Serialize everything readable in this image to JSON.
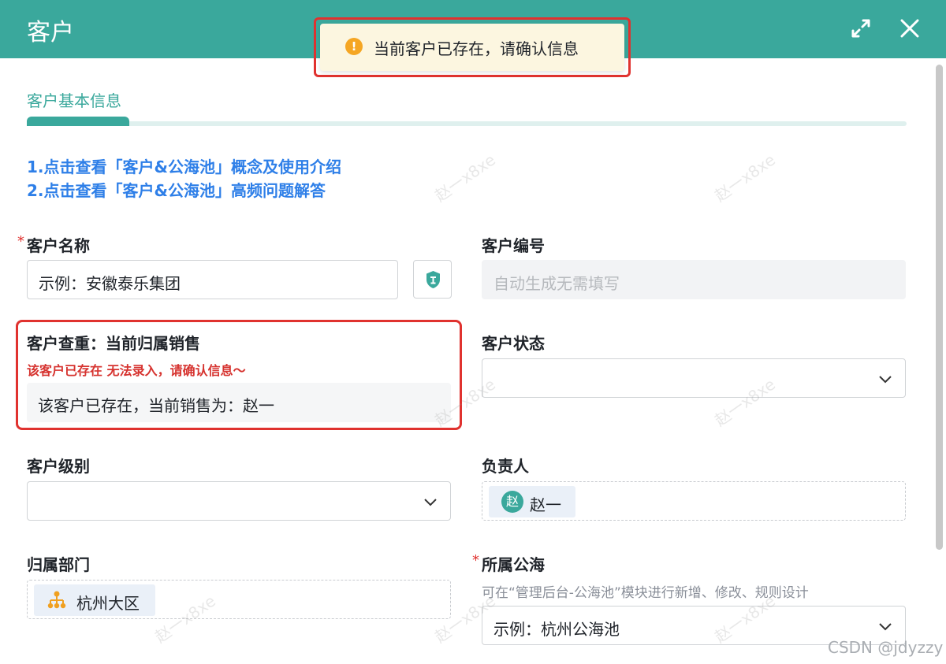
{
  "header": {
    "title": "客户",
    "background_color": "#3aa89c",
    "expand_icon": "expand-icon",
    "close_icon": "close-icon"
  },
  "toast": {
    "icon": "warning-icon",
    "icon_glyph": "!",
    "message": "当前客户已存在，请确认信息",
    "icon_color": "#f5a623"
  },
  "tabs": {
    "active_label": "客户基本信息"
  },
  "help_links": [
    "1.点击查看「客户&公海池」概念及使用介绍",
    "2.点击查看「客户&公海池」高频问题解答"
  ],
  "form": {
    "customer_name": {
      "label": "客户名称",
      "required_mark": "*",
      "value": "示例：安徽泰乐集团",
      "check_icon": "shield-icon"
    },
    "customer_number": {
      "label": "客户编号",
      "placeholder": "自动生成无需填写"
    },
    "duplicate_check": {
      "label": "客户查重：当前归属销售",
      "error": "该客户已存在 无法录入，请确认信息～",
      "value": "该客户已存在，当前销售为：赵一"
    },
    "customer_status": {
      "label": "客户状态",
      "value": ""
    },
    "customer_level": {
      "label": "客户级别",
      "value": ""
    },
    "owner": {
      "label": "负责人",
      "avatar_text": "赵",
      "name": "赵一"
    },
    "department": {
      "label": "归属部门",
      "icon": "org-chart-icon",
      "name": "杭州大区"
    },
    "sea_pool": {
      "label": "所属公海",
      "required_mark": "*",
      "hint": "可在“管理后台-公海池”模块进行新增、修改、规则设计",
      "value": "示例：杭州公海池"
    }
  },
  "watermark_text": "赵一x8xe",
  "credit": "CSDN @jdyzzy",
  "colors": {
    "accent": "#3aa89c",
    "error": "#e0322f",
    "link": "#2e7fe8"
  }
}
